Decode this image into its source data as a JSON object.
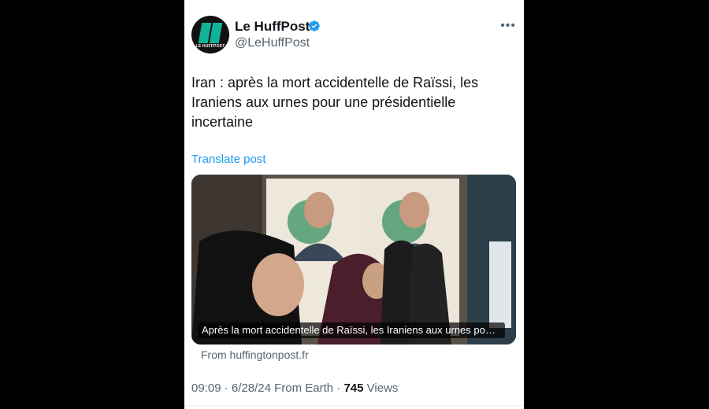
{
  "account": {
    "name": "Le HuffPost",
    "handle": "@LeHuffPost",
    "avatar_text": "LE HUFFPOST",
    "verified_color": "#1d9bf0"
  },
  "post": {
    "text": "Iran : après la mort accidentelle de Raïssi, les Iraniens aux urnes pour une présidentielle incertaine",
    "translate_label": "Translate post",
    "link_caption": "Après la mort accidentelle de Raïssi, les Iraniens aux urnes pour u...",
    "link_source": "From huffingtonpost.fr"
  },
  "meta": {
    "time": "09:09",
    "date": "6/28/24",
    "location": "From Earth",
    "views_count": "745",
    "views_label": "Views"
  },
  "icons": {
    "more": "more-icon",
    "verified": "verified-badge-icon"
  }
}
